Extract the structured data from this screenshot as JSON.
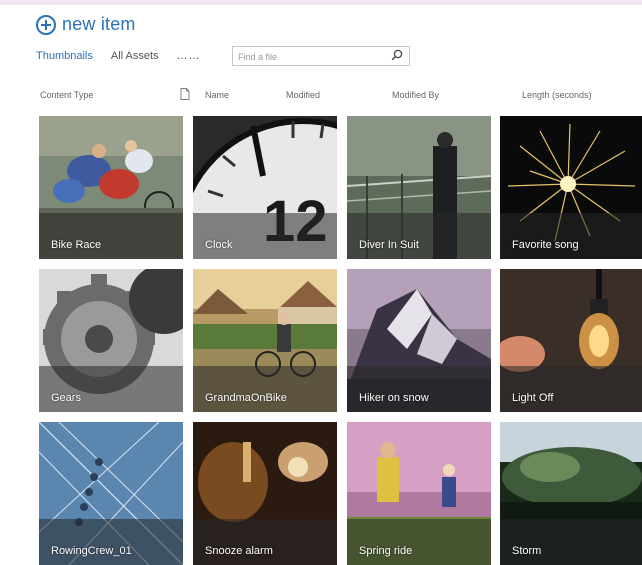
{
  "header": {
    "new_item_label": "new item"
  },
  "views": {
    "active": "Thumbnails",
    "other": "All Assets",
    "more": "……"
  },
  "search": {
    "placeholder": "Find a file"
  },
  "columns": [
    "Content Type",
    "Name",
    "Modified",
    "Modified By",
    "Length (seconds)"
  ],
  "tiles": [
    {
      "title": "Bike Race",
      "icon": "bike-race-image"
    },
    {
      "title": "Clock",
      "icon": "clock-image"
    },
    {
      "title": "Diver In Suit",
      "icon": "diver-in-suit-image"
    },
    {
      "title": "Favorite song",
      "icon": "fireworks-image"
    },
    {
      "title": "Gears",
      "icon": "gears-image"
    },
    {
      "title": "GrandmaOnBike",
      "icon": "grandma-on-bike-image"
    },
    {
      "title": "Hiker on snow",
      "icon": "hiker-on-snow-image"
    },
    {
      "title": "Light Off",
      "icon": "light-bulb-image"
    },
    {
      "title": "RowingCrew_01",
      "icon": "rowing-crew-image"
    },
    {
      "title": "Snooze alarm",
      "icon": "snooze-alarm-image"
    },
    {
      "title": "Spring ride",
      "icon": "spring-ride-image"
    },
    {
      "title": "Storm",
      "icon": "storm-image"
    }
  ],
  "colors": {
    "accent": "#2a72b8"
  }
}
